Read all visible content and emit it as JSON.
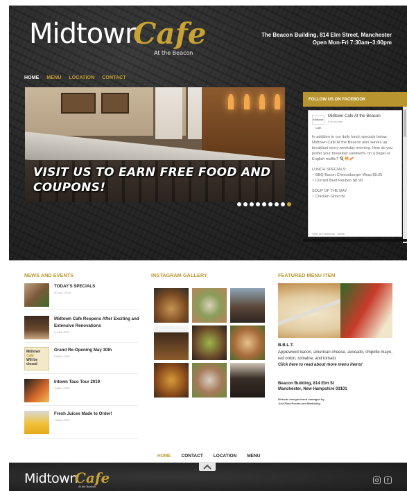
{
  "header": {
    "logo_main": "Midtown",
    "logo_script": "Cafe",
    "logo_sub": "At the Beacon",
    "address_line1": "The Beacon Building, 814 Elm Street, Manchester",
    "address_line2": "Open Mon-Fri 7:30am–3:00pm"
  },
  "nav": {
    "items": [
      "HOME",
      "MENU",
      "LOCATION",
      "CONTACT"
    ]
  },
  "slider": {
    "caption": "VISIT US TO EARN FREE FOOD AND COUPONS!",
    "dot_count": 9,
    "active_dot": 9
  },
  "facebook": {
    "header": "FOLLOW US ON FACEBOOK",
    "avatar_label": "Midtown Cafe",
    "page_name": "Midtown Cafe At the Beacon",
    "time": "6 hours ago",
    "post_paragraph1": "In addition to our daily lunch specials below, Midtown Cafe At the Beacon also serves up breakfast every weekday morning. How do you prefer your breakfast sandwich- on a bagel or English muffin? 🍳🥯🥓",
    "lunch_specials_title": "LUNCH SPECIALS:",
    "lunch_special_1": "~ BBQ Bacon Cheeseburger Wrap $9.25",
    "lunch_special_2": "~ Corned Beef Reuben $8.99",
    "soup_title": "SOUP OF THE DAY:",
    "soup_1": "~ Chicken Gnocchi",
    "links": "View on Facebook · Share"
  },
  "news": {
    "title": "NEWS AND EVENTS",
    "items": [
      {
        "headline": "TODAY'S SPECIALS",
        "date": "30 JUL, 2019"
      },
      {
        "headline": "Midtown Cafe Reopens After Exciting and Extensive Renovations",
        "date": "6 JUN, 2019"
      },
      {
        "headline": "Grand Re-Opening May 30th",
        "date": "5 MAY, 2019"
      },
      {
        "headline": "Intown Taco Tour 2019",
        "date": "3 MAY, 2019"
      },
      {
        "headline": "Fresh Juices Made to Order!",
        "date": "1 MAY, 2019"
      }
    ],
    "thumb3_line1": "Midtown",
    "thumb3_line2": "Cafe",
    "thumb3_line3": "Will be closed"
  },
  "instagram": {
    "title": "INSTAGRAM GALLERY"
  },
  "featured": {
    "title": "FEATURED MENU ITEM",
    "name": "B.B.L.T.",
    "description": "Applewood bacon, american cheese, avocado, chipotle mayo, red onion, romaine, and tomato",
    "link": "Click here to read about more menu items!",
    "address_line1": "Beacon Building, 814 Elm St",
    "address_line2": "Manchester, New Hampshire 03101",
    "credit_line1": "Website designed and managed by",
    "credit_line2": "Just Flow Events and Marketing"
  },
  "bottom_nav": {
    "items": [
      "HOME",
      "CONTACT",
      "LOCATION",
      "MENU"
    ]
  },
  "footer": {
    "logo_main": "Midtown",
    "logo_script": "Cafe",
    "logo_sub": "At the Beacon",
    "scroll_top_icon": "chevron-up-icon",
    "social_icons": [
      "instagram-icon",
      "facebook-icon"
    ]
  },
  "colors": {
    "accent_gold": "#c8a235",
    "dark_background": "#262626"
  }
}
